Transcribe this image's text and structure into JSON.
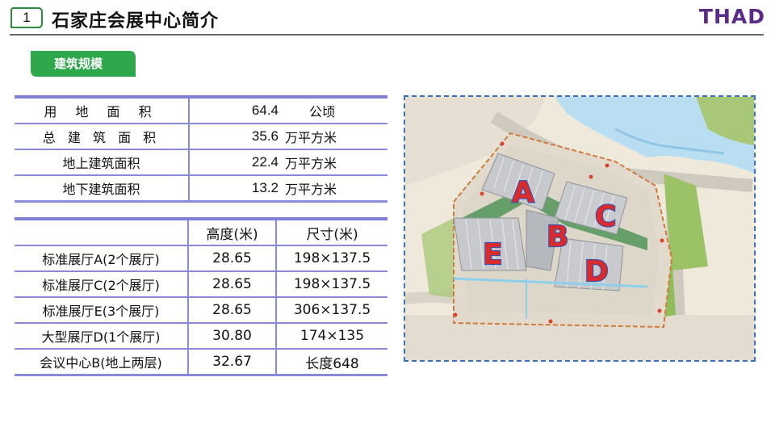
{
  "header": {
    "section_number": "1",
    "title": "石家庄会展中心简介",
    "brand": "THAD"
  },
  "section_label": "建筑规模",
  "area_table": {
    "rows": [
      {
        "label": "用 地 面 积",
        "value": "64.4",
        "unit": "公顷"
      },
      {
        "label": "总 建 筑 面 积",
        "value": "35.6",
        "unit": "万平方米"
      },
      {
        "label": "地上建筑面积",
        "value": "22.4",
        "unit": "万平方米"
      },
      {
        "label": "地下建筑面积",
        "value": "13.2",
        "unit": "万平方米"
      }
    ]
  },
  "hall_table": {
    "headers": [
      "",
      "高度(米)",
      "尺寸(米)"
    ],
    "rows": [
      [
        "标准展厅A(2个展厅)",
        "28.65",
        "198×137.5"
      ],
      [
        "标准展厅C(2个展厅)",
        "28.65",
        "198×137.5"
      ],
      [
        "标准展厅E(3个展厅)",
        "28.65",
        "306×137.5"
      ],
      [
        "大型展厅D(1个展厅)",
        "30.80",
        "174×135"
      ],
      [
        "会议中心B(地上两层)",
        "32.67",
        "长度648"
      ]
    ]
  },
  "site_plan": {
    "labels": [
      "A",
      "B",
      "C",
      "D",
      "E"
    ],
    "label_color": "#d92b2b",
    "label_outline": "#3552b8"
  },
  "colors": {
    "accent_green": "#2ea84a",
    "brand_purple": "#5b2b8a",
    "table_rule": "#7f7fd6"
  }
}
